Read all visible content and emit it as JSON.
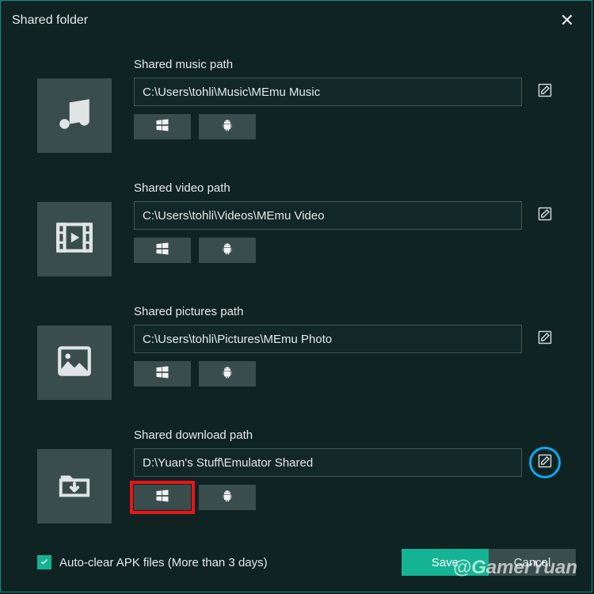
{
  "title": "Shared folder",
  "sections": [
    {
      "key": "music",
      "label": "Shared music path",
      "path": "C:\\Users\\tohli\\Music\\MEmu Music",
      "edit_highlight": false,
      "win_highlight": false
    },
    {
      "key": "video",
      "label": "Shared video path",
      "path": "C:\\Users\\tohli\\Videos\\MEmu Video",
      "edit_highlight": false,
      "win_highlight": false
    },
    {
      "key": "pictures",
      "label": "Shared pictures path",
      "path": "C:\\Users\\tohli\\Pictures\\MEmu Photo",
      "edit_highlight": false,
      "win_highlight": false
    },
    {
      "key": "download",
      "label": "Shared download path",
      "path": "D:\\Yuan's Stuff\\Emulator Shared",
      "edit_highlight": true,
      "win_highlight": true
    }
  ],
  "icons": {
    "music": "music-icon",
    "video": "video-icon",
    "pictures": "picture-icon",
    "download": "download-folder-icon"
  },
  "autoclear": {
    "checked": true,
    "label": "Auto-clear APK files (More than 3 days)"
  },
  "buttons": {
    "save": "Save",
    "cancel": "Cancel"
  },
  "watermark": "@GamerYuan",
  "colors": {
    "accent": "#14b393",
    "highlight_blue": "#0aa8ef",
    "highlight_red": "#ee1414"
  }
}
